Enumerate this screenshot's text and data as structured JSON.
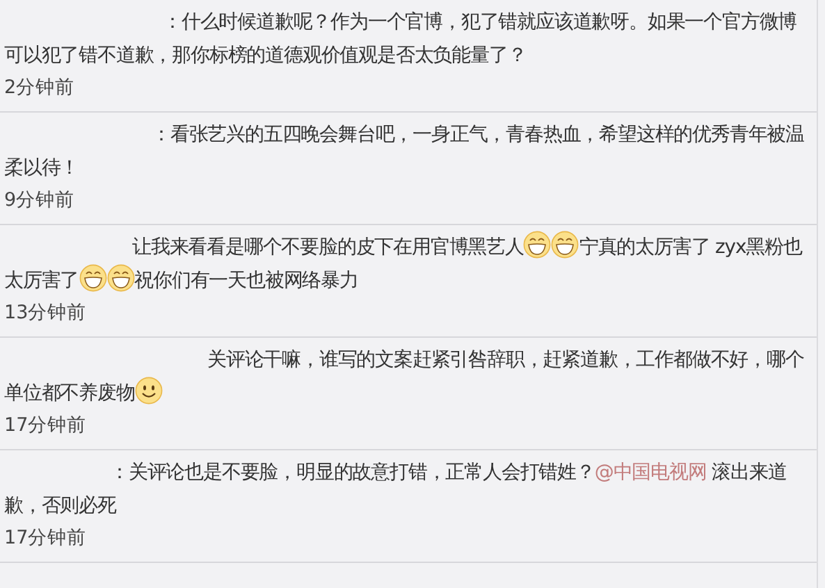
{
  "comments": [
    {
      "segments": [
        {
          "kind": "text",
          "text": "：什么时候道歉呢？作为一个官博，犯了错就应该道歉呀。如果一个官方微博可以犯了错不道歉，那你标榜的道德观价值观是否太负能量了？"
        }
      ],
      "time": "2分钟前"
    },
    {
      "segments": [
        {
          "kind": "text",
          "text": "：看张艺兴的五四晚会舞台吧，一身正气，青春热血，希望这样的优秀青年被温柔以待！"
        }
      ],
      "time": "9分钟前"
    },
    {
      "segments": [
        {
          "kind": "text",
          "text": "让我来看看是哪个不要脸的皮下在用官博黑艺人"
        },
        {
          "kind": "grin"
        },
        {
          "kind": "grin"
        },
        {
          "kind": "text",
          "text": "宁真的太厉害了 zyx黑粉也太厉害了"
        },
        {
          "kind": "grin"
        },
        {
          "kind": "grin"
        },
        {
          "kind": "text",
          "text": "祝你们有一天也被网络暴力"
        }
      ],
      "time": "13分钟前"
    },
    {
      "segments": [
        {
          "kind": "text",
          "text": "关评论干嘛，谁写的文案赶紧引咎辞职，赶紧道歉，工作都做不好，哪个单位都不养废物"
        },
        {
          "kind": "smile"
        }
      ],
      "time": "17分钟前"
    },
    {
      "segments": [
        {
          "kind": "text",
          "text": "：关评论也是不要脸，明显的故意打错，正常人会打错姓？"
        },
        {
          "kind": "link",
          "text": "@中国电视网"
        },
        {
          "kind": "text",
          "text": " 滚出来道歉，否则必死"
        }
      ],
      "time": "17分钟前"
    }
  ]
}
